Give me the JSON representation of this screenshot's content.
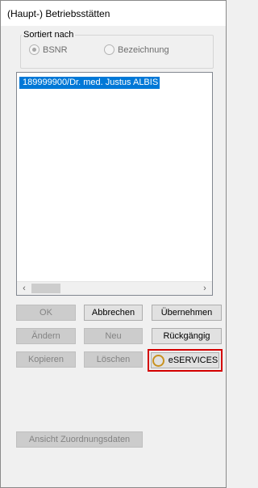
{
  "window": {
    "title": "(Haupt-) Betriebsstätten"
  },
  "sort_group": {
    "label": "Sortiert nach",
    "options": [
      {
        "label": "BSNR",
        "checked": true
      },
      {
        "label": "Bezeichnung",
        "checked": false
      }
    ]
  },
  "list": {
    "items": [
      {
        "label": "189999900/Dr. med. Justus ALBIS",
        "selected": true
      }
    ],
    "scroll_left_glyph": "‹",
    "scroll_right_glyph": "›"
  },
  "buttons": {
    "ok": "OK",
    "abbrechen": "Abbrechen",
    "uebernehmen": "Übernehmen",
    "aendern": "Ändern",
    "neu": "Neu",
    "rueckgaengig": "Rückgängig",
    "kopieren": "Kopieren",
    "loeschen": "Löschen",
    "eservices": "eSERVICES",
    "ansicht": "Ansicht Zuordnungsdaten"
  },
  "colors": {
    "selection": "#0078d7",
    "highlight_border": "#d40000",
    "eservices_ring": "#c89220"
  }
}
